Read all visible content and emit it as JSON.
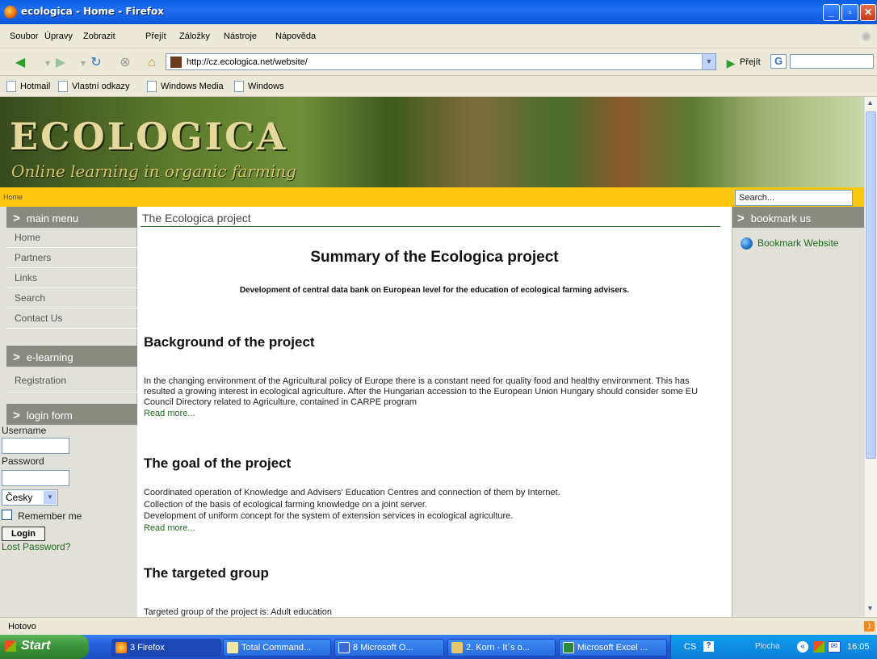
{
  "window": {
    "title": "ecologica - Home - Firefox"
  },
  "menu": [
    "Soubor",
    "Úpravy",
    "Zobrazit",
    "Přejít",
    "Záložky",
    "Nástroje",
    "Nápověda"
  ],
  "nav": {
    "url": "http://cz.ecologica.net/website/",
    "go_label": "Přejít",
    "search_letter": "G"
  },
  "bookmarks": [
    "Hotmail",
    "Vlastní odkazy",
    "Windows Media",
    "Windows"
  ],
  "banner": {
    "logo": "ECOLOGICA",
    "tagline": "Online learning in organic farming"
  },
  "breadcrumb": "Home",
  "search": {
    "placeholder": "Search..."
  },
  "left": {
    "main_menu_title": "main menu",
    "main_menu": [
      "Home",
      "Partners",
      "Links",
      "Search",
      "Contact Us"
    ],
    "elearning_title": "e-learning",
    "elearning": [
      "Registration"
    ],
    "login_title": "login form",
    "username_label": "Username",
    "password_label": "Password",
    "language": "Česky",
    "remember": "Remember me",
    "login_button": "Login",
    "lost_password": "Lost Password?"
  },
  "main": {
    "section_title": "The Ecologica project",
    "summary_title": "Summary of the Ecologica project",
    "summary_subtitle": "Development of central data bank on European level for the education of ecological farming advisers.",
    "bg_heading": "Background of the project",
    "bg_text": "In the changing environment of the Agricultural policy of Europe there is a constant need for quality food and healthy environment. This has resulted a growing interest in ecological agriculture. After the Hungarian accession to the European Union Hungary should consider some EU Council Directory related to Agriculture, contained in CARPE program",
    "read_more": "Read more...",
    "goal_heading": "The goal of the project",
    "goal_lines": [
      "Coordinated operation of Knowledge and Advisers' Education Centres and connection of them by Internet.",
      "Collection of the basis of ecological farming knowledge on a joint server.",
      "Development of uniform concept for the system of extension services in ecological agriculture."
    ],
    "target_heading": "The targeted group",
    "target_text": "Targeted group of the project is: Adult education"
  },
  "right": {
    "title": "bookmark us",
    "link": "Bookmark Website"
  },
  "status": "Hotovo",
  "taskbar": {
    "start": "Start",
    "items": [
      "3 Firefox",
      "Total Command...",
      "8 Microsoft O...",
      "2. Korn - It´s o...",
      "Microsoft Excel ..."
    ],
    "lang": "CS",
    "plocha": "Plocha",
    "time": "16:05"
  },
  "colors": {
    "accent_yellow": "#fec70f",
    "sidebar_header": "#898a80",
    "link_green": "#1e6b1e"
  }
}
